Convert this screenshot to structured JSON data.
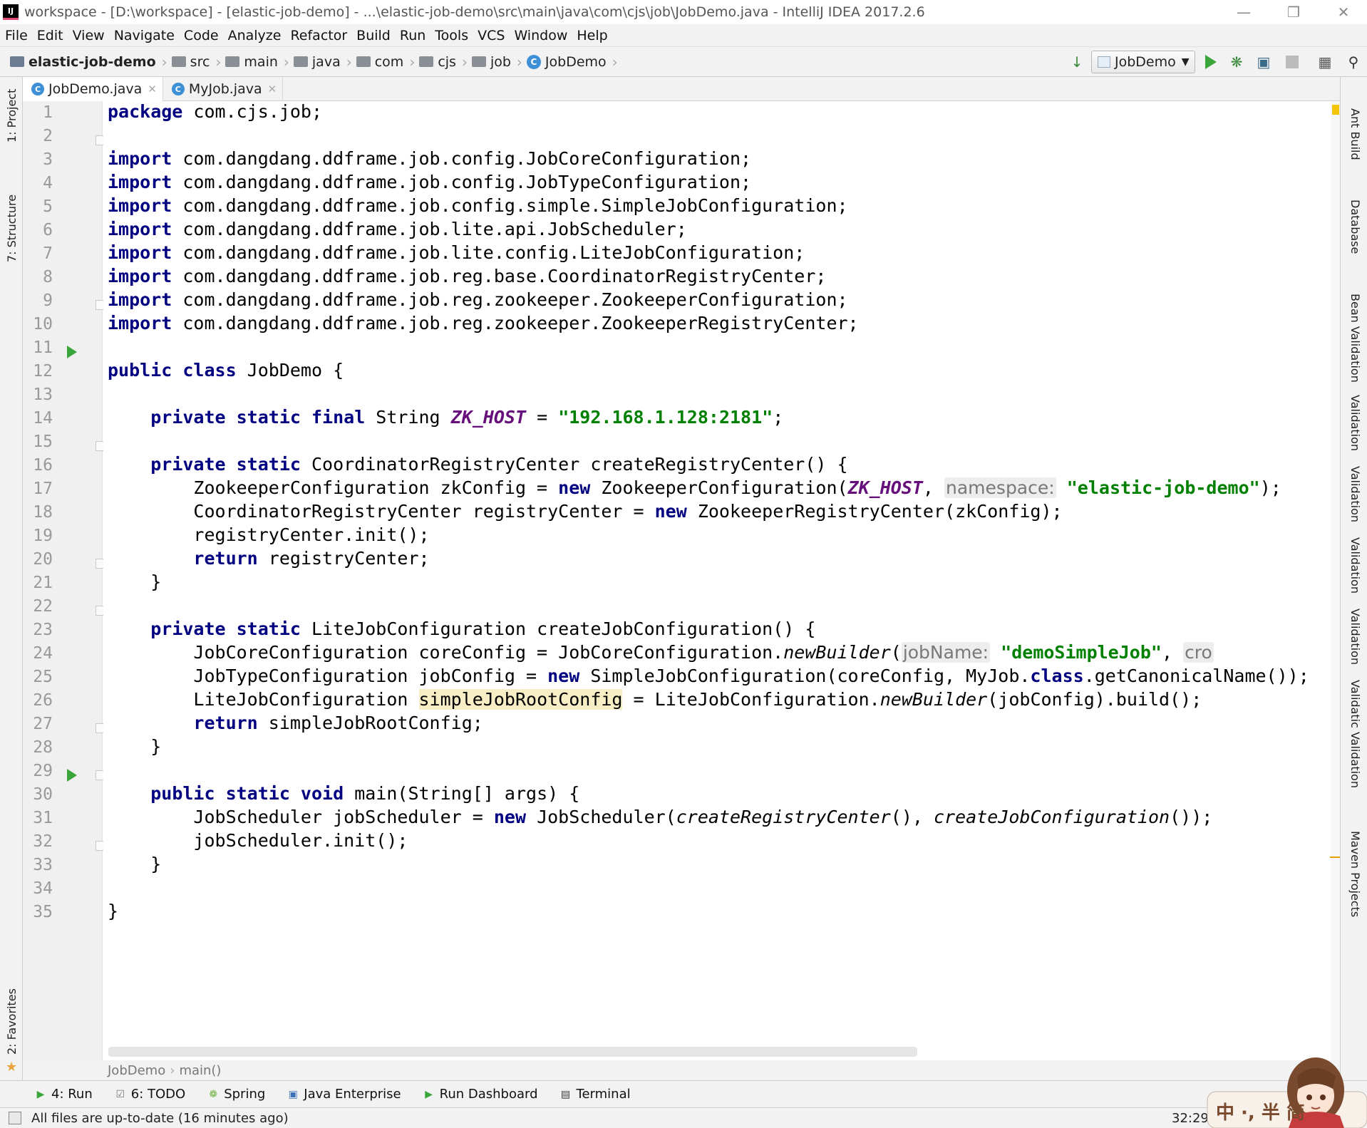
{
  "window": {
    "title": "workspace - [D:\\workspace] - [elastic-job-demo] - ...\\elastic-job-demo\\src\\main\\java\\com\\cjs\\job\\JobDemo.java - IntelliJ IDEA 2017.2.6",
    "app_icon_text": "IJ"
  },
  "menu": [
    "File",
    "Edit",
    "View",
    "Navigate",
    "Code",
    "Analyze",
    "Refactor",
    "Build",
    "Run",
    "Tools",
    "VCS",
    "Window",
    "Help"
  ],
  "nav_breadcrumb": [
    "elastic-job-demo",
    "src",
    "main",
    "java",
    "com",
    "cjs",
    "job",
    "JobDemo"
  ],
  "run_config": "JobDemo",
  "toolbar_icons": [
    "sort-icon",
    "run-icon",
    "debug-icon",
    "coverage-icon",
    "stop-icon",
    "project-structure-icon",
    "search-icon"
  ],
  "tabs": [
    {
      "label": "JobDemo.java",
      "active": true
    },
    {
      "label": "MyJob.java",
      "active": false
    }
  ],
  "left_tool_windows": [
    "1: Project",
    "7: Structure",
    "2: Favorites"
  ],
  "right_tool_windows": [
    "Ant Build",
    "Database",
    "Bean Validation",
    "Validation",
    "Validation",
    "Validation",
    "Validation",
    "Validatic Validation",
    "Maven Projects"
  ],
  "code": {
    "line_numbers": [
      "1",
      "2",
      "3",
      "4",
      "5",
      "6",
      "7",
      "8",
      "9",
      "10",
      "11",
      "12",
      "13",
      "14",
      "15",
      "16",
      "17",
      "18",
      "19",
      "20",
      "21",
      "22",
      "23",
      "24",
      "25",
      "26",
      "27",
      "28",
      "29",
      "30",
      "31",
      "32",
      "33",
      "34",
      "35"
    ],
    "current_line": 32,
    "run_markers_lines": [
      12,
      30
    ],
    "lines": [
      [
        {
          "t": "kw",
          "v": "package"
        },
        {
          "t": "n",
          "v": " com.cjs.job;"
        }
      ],
      [],
      [
        {
          "t": "kw",
          "v": "import"
        },
        {
          "t": "n",
          "v": " com.dangdang.ddframe.job.config.JobCoreConfiguration;"
        }
      ],
      [
        {
          "t": "kw",
          "v": "import"
        },
        {
          "t": "n",
          "v": " com.dangdang.ddframe.job.config.JobTypeConfiguration;"
        }
      ],
      [
        {
          "t": "kw",
          "v": "import"
        },
        {
          "t": "n",
          "v": " com.dangdang.ddframe.job.config.simple.SimpleJobConfiguration;"
        }
      ],
      [
        {
          "t": "kw",
          "v": "import"
        },
        {
          "t": "n",
          "v": " com.dangdang.ddframe.job.lite.api.JobScheduler;"
        }
      ],
      [
        {
          "t": "kw",
          "v": "import"
        },
        {
          "t": "n",
          "v": " com.dangdang.ddframe.job.lite.config.LiteJobConfiguration;"
        }
      ],
      [
        {
          "t": "kw",
          "v": "import"
        },
        {
          "t": "n",
          "v": " com.dangdang.ddframe.job.reg.base.CoordinatorRegistryCenter;"
        }
      ],
      [
        {
          "t": "kw",
          "v": "import"
        },
        {
          "t": "n",
          "v": " com.dangdang.ddframe.job.reg.zookeeper.ZookeeperConfiguration;"
        }
      ],
      [
        {
          "t": "kw",
          "v": "import"
        },
        {
          "t": "n",
          "v": " com.dangdang.ddframe.job.reg.zookeeper.ZookeeperRegistryCenter;"
        }
      ],
      [],
      [
        {
          "t": "kw",
          "v": "public class"
        },
        {
          "t": "n",
          "v": " JobDemo {"
        }
      ],
      [],
      [
        {
          "t": "n",
          "v": "    "
        },
        {
          "t": "kw",
          "v": "private static final"
        },
        {
          "t": "n",
          "v": " String "
        },
        {
          "t": "stat",
          "v": "ZK_HOST"
        },
        {
          "t": "n",
          "v": " = "
        },
        {
          "t": "str",
          "v": "\"192.168.1.128:2181\""
        },
        {
          "t": "n",
          "v": ";"
        }
      ],
      [],
      [
        {
          "t": "n",
          "v": "    "
        },
        {
          "t": "kw",
          "v": "private static"
        },
        {
          "t": "n",
          "v": " CoordinatorRegistryCenter createRegistryCenter() {"
        }
      ],
      [
        {
          "t": "n",
          "v": "        ZookeeperConfiguration zkConfig = "
        },
        {
          "t": "kw",
          "v": "new"
        },
        {
          "t": "n",
          "v": " ZookeeperConfiguration("
        },
        {
          "t": "stat",
          "v": "ZK_HOST"
        },
        {
          "t": "n",
          "v": ", "
        },
        {
          "t": "hint",
          "v": "namespace:"
        },
        {
          "t": "n",
          "v": " "
        },
        {
          "t": "str",
          "v": "\"elastic-job-demo\""
        },
        {
          "t": "n",
          "v": ");"
        }
      ],
      [
        {
          "t": "n",
          "v": "        CoordinatorRegistryCenter registryCenter = "
        },
        {
          "t": "kw",
          "v": "new"
        },
        {
          "t": "n",
          "v": " ZookeeperRegistryCenter(zkConfig);"
        }
      ],
      [
        {
          "t": "n",
          "v": "        registryCenter.init();"
        }
      ],
      [
        {
          "t": "n",
          "v": "        "
        },
        {
          "t": "kw",
          "v": "return"
        },
        {
          "t": "n",
          "v": " registryCenter;"
        }
      ],
      [
        {
          "t": "n",
          "v": "    }"
        }
      ],
      [],
      [
        {
          "t": "n",
          "v": "    "
        },
        {
          "t": "kw",
          "v": "private static"
        },
        {
          "t": "n",
          "v": " LiteJobConfiguration createJobConfiguration() {"
        }
      ],
      [
        {
          "t": "n",
          "v": "        JobCoreConfiguration coreConfig = JobCoreConfiguration."
        },
        {
          "t": "ital",
          "v": "newBuilder"
        },
        {
          "t": "n",
          "v": "("
        },
        {
          "t": "hint",
          "v": "jobName:"
        },
        {
          "t": "n",
          "v": " "
        },
        {
          "t": "str",
          "v": "\"demoSimpleJob\""
        },
        {
          "t": "n",
          "v": ", "
        },
        {
          "t": "hint",
          "v": "cro"
        }
      ],
      [
        {
          "t": "n",
          "v": "        JobTypeConfiguration jobConfig = "
        },
        {
          "t": "kw",
          "v": "new"
        },
        {
          "t": "n",
          "v": " SimpleJobConfiguration(coreConfig, MyJob."
        },
        {
          "t": "kw",
          "v": "class"
        },
        {
          "t": "n",
          "v": ".getCanonicalName());"
        }
      ],
      [
        {
          "t": "n",
          "v": "        LiteJobConfiguration "
        },
        {
          "t": "hl",
          "v": "simpleJobRootConfig"
        },
        {
          "t": "n",
          "v": " = LiteJobConfiguration."
        },
        {
          "t": "ital",
          "v": "newBuilder"
        },
        {
          "t": "n",
          "v": "(jobConfig).build();"
        }
      ],
      [
        {
          "t": "n",
          "v": "        "
        },
        {
          "t": "kw",
          "v": "return"
        },
        {
          "t": "n",
          "v": " simpleJobRootConfig;"
        }
      ],
      [
        {
          "t": "n",
          "v": "    }"
        }
      ],
      [],
      [
        {
          "t": "n",
          "v": "    "
        },
        {
          "t": "kw",
          "v": "public static void"
        },
        {
          "t": "n",
          "v": " main(String[] args) {"
        }
      ],
      [
        {
          "t": "n",
          "v": "        JobScheduler jobScheduler = "
        },
        {
          "t": "kw",
          "v": "new"
        },
        {
          "t": "n",
          "v": " JobScheduler("
        },
        {
          "t": "ital",
          "v": "createRegistryCenter"
        },
        {
          "t": "n",
          "v": "(), "
        },
        {
          "t": "ital",
          "v": "createJobConfiguration"
        },
        {
          "t": "n",
          "v": "());"
        }
      ],
      [
        {
          "t": "n",
          "v": "        jobScheduler.init();"
        }
      ],
      [
        {
          "t": "n",
          "v": "    }"
        }
      ],
      [],
      [
        {
          "t": "n",
          "v": "}"
        }
      ]
    ]
  },
  "editor_breadcrumb": [
    "JobDemo",
    "main()"
  ],
  "bottom_tools": [
    {
      "label": "4: Run",
      "icon": "run-icon"
    },
    {
      "label": "6: TODO",
      "icon": "todo-icon"
    },
    {
      "label": "Spring",
      "icon": "spring-icon"
    },
    {
      "label": "Java Enterprise",
      "icon": "java-enterprise-icon"
    },
    {
      "label": "Run Dashboard",
      "icon": "run-dashboard-icon"
    },
    {
      "label": "Terminal",
      "icon": "terminal-icon"
    }
  ],
  "status": {
    "message": "All files are up-to-date (16 minutes ago)",
    "position": "32:29"
  },
  "watermark_text": "中 ·, 半 简",
  "colors": {
    "keyword": "#000080",
    "string": "#008000",
    "static_field": "#660e7a",
    "current_line": "#fffae3",
    "run_green": "#3aa53a"
  }
}
